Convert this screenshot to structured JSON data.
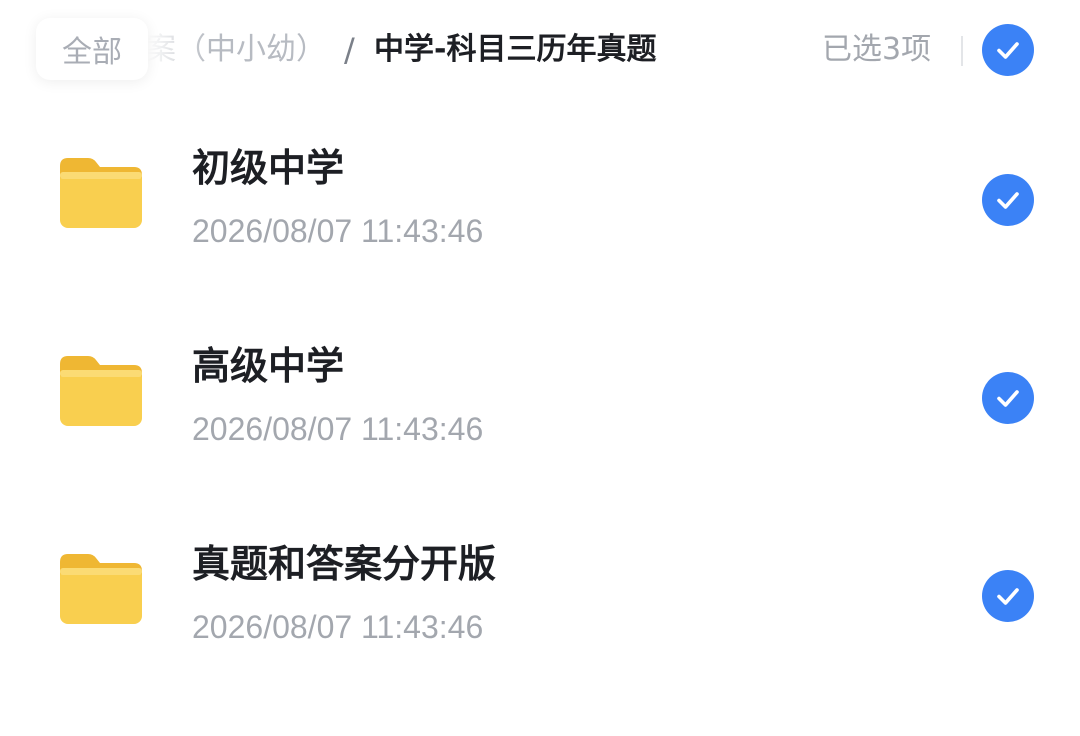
{
  "header": {
    "all_label": "全部",
    "breadcrumb_prev": "案（中小幼）",
    "breadcrumb_separator": "/",
    "breadcrumb_current": "中学-科目三历年真题",
    "selected_count": "已选3项"
  },
  "files": [
    {
      "name": "初级中学",
      "date": "2026/08/07 11:43:46",
      "icon": "folder-icon",
      "selected": true
    },
    {
      "name": "高级中学",
      "date": "2026/08/07 11:43:46",
      "icon": "folder-icon",
      "selected": true
    },
    {
      "name": "真题和答案分开版",
      "date": "2026/08/07 11:43:46",
      "icon": "folder-icon",
      "selected": true
    }
  ],
  "colors": {
    "accent": "#3b82f6",
    "folder": "#f9cf4f",
    "text_primary": "#1d1f24",
    "text_secondary": "#a3a7ae"
  }
}
